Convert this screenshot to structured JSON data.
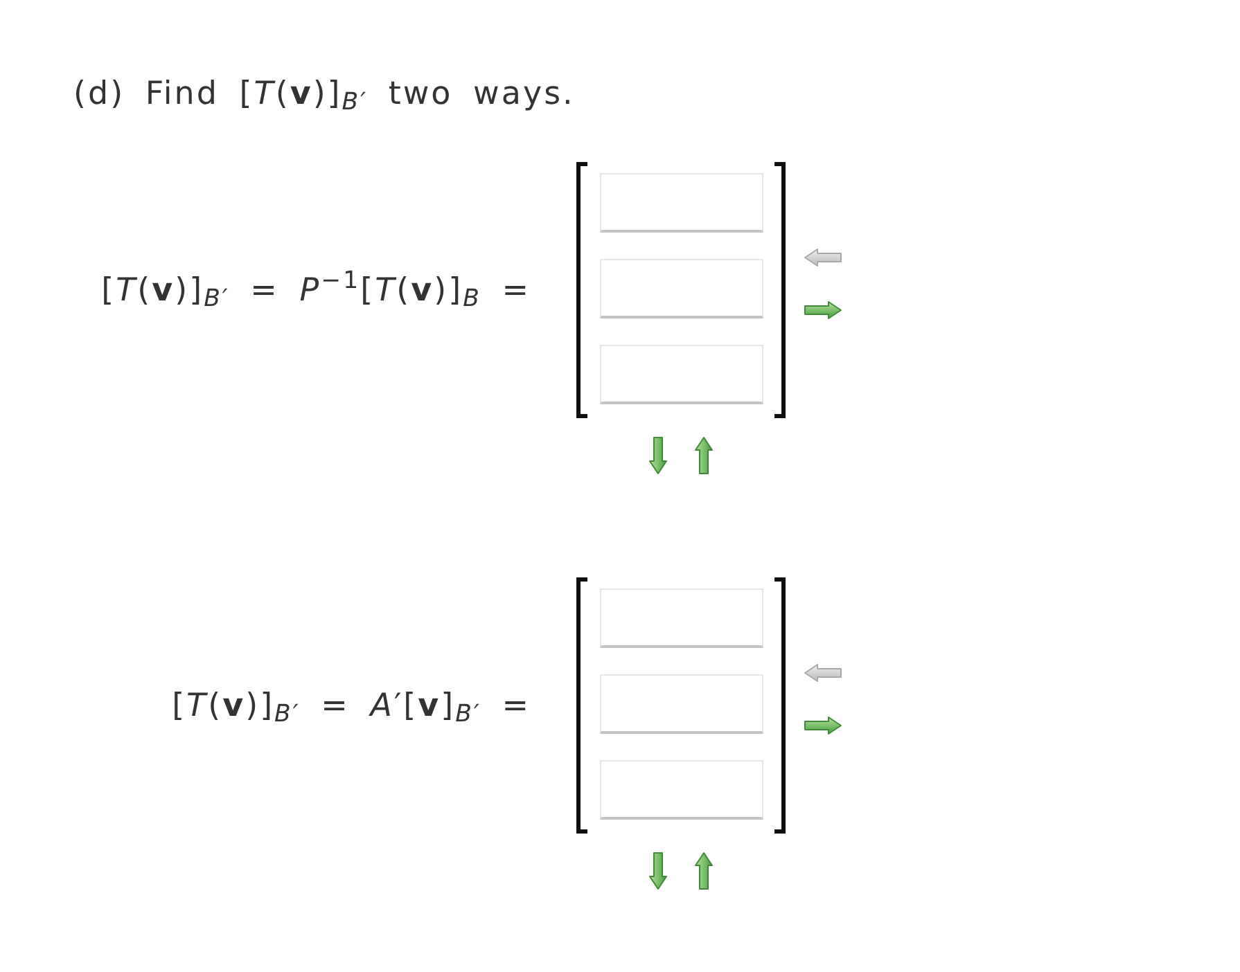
{
  "title": "(d) Find [*T*(**v**)]$_{B′}$ two ways.",
  "parts": [
    {
      "equation": "[*T*(**v**)]$_{B′}$ = *P*$^{−1}$[*T*(**v**)]$_{B}$ =",
      "matrix": {
        "entries": [
          {
            "kind": "text_input"
          },
          {
            "kind": "text_input"
          },
          {
            "kind": "text_input"
          }
        ]
      },
      "side_arrows": [
        {
          "kind": "left",
          "disabled": true
        },
        {
          "kind": "right",
          "disabled": false
        }
      ],
      "bottom_arrows": [
        {
          "kind": "down",
          "disabled": false
        },
        {
          "kind": "up",
          "disabled": false
        }
      ]
    },
    {
      "equation": "[*T*(**v**)]$_{B′}$ = *A*′[**v**]$_{B′}$ =",
      "matrix": {
        "entries": [
          {
            "kind": "text_input"
          },
          {
            "kind": "text_input"
          },
          {
            "kind": "text_input"
          }
        ]
      },
      "side_arrows": [
        {
          "kind": "left",
          "disabled": true
        },
        {
          "kind": "right",
          "disabled": false
        }
      ],
      "bottom_arrows": [
        {
          "kind": "down",
          "disabled": false
        },
        {
          "kind": "up",
          "disabled": false
        }
      ]
    }
  ]
}
